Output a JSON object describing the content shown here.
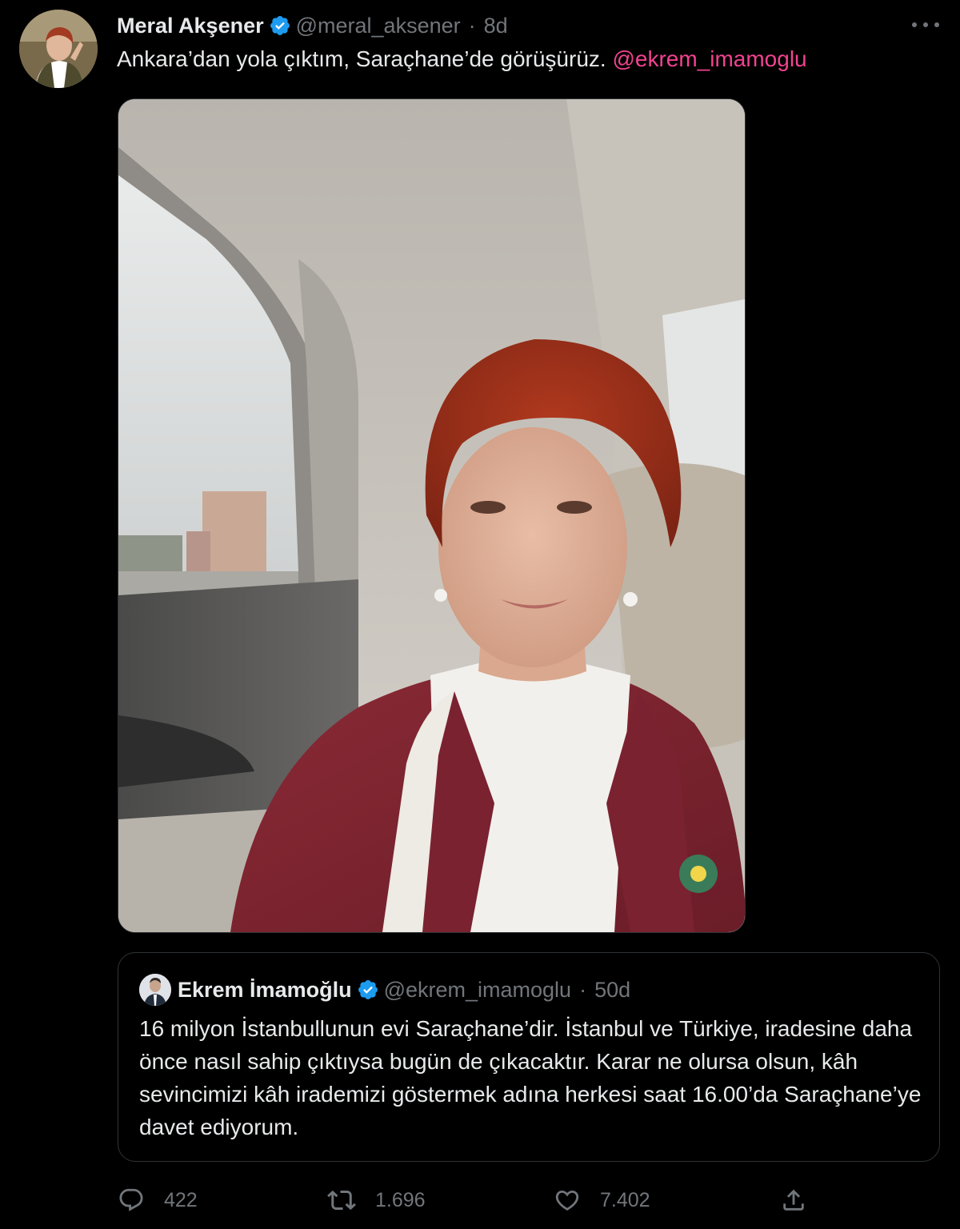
{
  "tweet": {
    "display_name": "Meral Akşener",
    "handle": "@meral_aksener",
    "separator": "·",
    "time": "8d",
    "text": "Ankara’dan yola çıktım, Saraçhane’de görüşürüz.",
    "mention": "@ekrem_imamoglu",
    "image_description": "Selfie photo taken in the back seat of a car"
  },
  "quoted_tweet": {
    "display_name": "Ekrem İmamoğlu",
    "handle": "@ekrem_imamoglu",
    "separator": "·",
    "time": "50d",
    "text": "16 milyon İstanbullunun evi Saraçhane’dir. İstanbul ve Türkiye, iradesine daha önce nasıl sahip çıktıysa bugün de çıkacaktır. Karar ne olursa olsun, kâh sevincimizi kâh irademizi göstermek adına herkesi saat 16.00’da Saraçhane’ye davet ediyorum."
  },
  "actions": {
    "replies": "422",
    "retweets": "1.696",
    "likes": "7.402"
  },
  "icons": [
    "verified-badge-icon",
    "more-icon",
    "reply-icon",
    "retweet-icon",
    "like-icon",
    "share-icon"
  ],
  "colors": {
    "background": "#000000",
    "text": "#e7e9ea",
    "secondary": "#71767b",
    "mention": "#f0438f",
    "verified": "#1d9bf0",
    "border": "#2f3336"
  }
}
